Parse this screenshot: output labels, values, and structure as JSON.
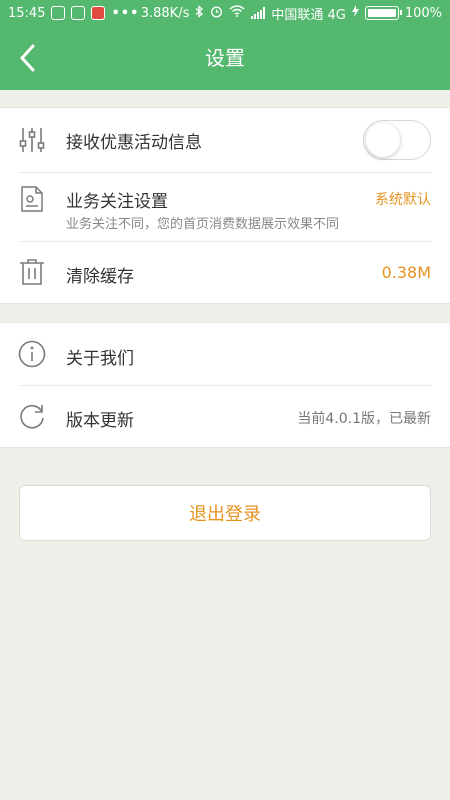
{
  "status_bar": {
    "time": "15:45",
    "speed": "3.88K/s",
    "carrier": "中国联通 4G",
    "battery": "100%",
    "battery_level": 1.0
  },
  "header": {
    "back_icon": "chevron-left-icon",
    "title": "设置"
  },
  "settings": {
    "promo": {
      "icon": "sliders-icon",
      "label": "接收优惠活动信息",
      "toggle_on": false
    },
    "business": {
      "icon": "document-settings-icon",
      "label": "业务关注设置",
      "sublabel": "业务关注不同，您的首页消费数据展示效果不同",
      "value": "系统默认"
    },
    "cache": {
      "icon": "trash-icon",
      "label": "清除缓存",
      "value": "0.38M"
    },
    "about": {
      "icon": "info-icon",
      "label": "关于我们"
    },
    "version": {
      "icon": "refresh-icon",
      "label": "版本更新",
      "value": "当前4.0.1版，已最新"
    }
  },
  "logout": {
    "label": "退出登录"
  },
  "colors": {
    "brand_green": "#55b86f",
    "accent_orange": "#e59421",
    "background": "#f0f0eb"
  }
}
